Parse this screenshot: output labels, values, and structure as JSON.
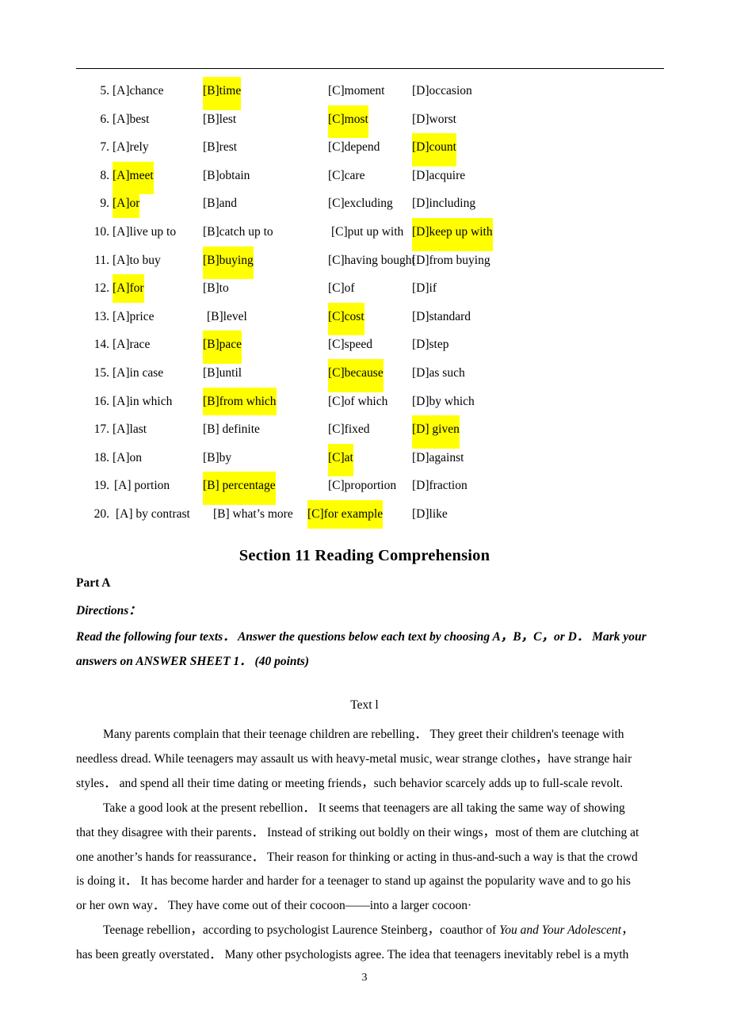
{
  "document": {
    "page_number": "3",
    "highlight_color": "#ffff00",
    "rule_color": "#000000"
  },
  "cloze": {
    "rows": [
      {
        "num": "5.",
        "a": "[A]chance",
        "b": "[B]time",
        "c": "[C]moment",
        "d": "[D]occasion",
        "highlight": "b"
      },
      {
        "num": "6.",
        "a": "[A]best",
        "b": "[B]lest",
        "c": "[C]most",
        "d": "[D]worst",
        "highlight": "c"
      },
      {
        "num": "7.",
        "a": "[A]rely",
        "b": "[B]rest",
        "c": "[C]depend",
        "d": "[D]count",
        "highlight": "d"
      },
      {
        "num": "8.",
        "a": "[A]meet",
        "b": "[B]obtain",
        "c": "[C]care",
        "d": "[D]acquire",
        "highlight": "a"
      },
      {
        "num": "9.",
        "a": "[A]or",
        "b": "[B]and",
        "c": "[C]excluding",
        "d": "[D]including",
        "highlight": "a"
      },
      {
        "num": "10.",
        "a": "[A]live up to",
        "b": "[B]catch up to",
        "c": "[C]put up with",
        "d": "[D]keep up with",
        "highlight": "d"
      },
      {
        "num": "11.",
        "a": "[A]to buy",
        "b": "[B]buying",
        "c": "[C]having bought",
        "d": "[D]from buying",
        "highlight": "b"
      },
      {
        "num": "12.",
        "a": "[A]for",
        "b": "[B]to",
        "c": "[C]of",
        "d": "[D]if",
        "highlight": "a"
      },
      {
        "num": "13.",
        "a": "[A]price",
        "b": "[B]level",
        "c": "[C]cost",
        "d": "[D]standard",
        "highlight": "c"
      },
      {
        "num": "14.",
        "a": "[A]race",
        "b": "[B]pace",
        "c": "[C]speed",
        "d": "[D]step",
        "highlight": "b"
      },
      {
        "num": "15.",
        "a": "[A]in case",
        "b": "[B]until",
        "c": "[C]because",
        "d": "[D]as such",
        "highlight": "c"
      },
      {
        "num": "16.",
        "a": "[A]in which",
        "b": "[B]from which",
        "c": "[C]of which",
        "d": "[D]by which",
        "highlight": "b"
      },
      {
        "num": "17.",
        "a": "[A]last",
        "b": "[B] definite",
        "c": "[C]fixed",
        "d": "[D] given",
        "highlight": "d"
      },
      {
        "num": "18.",
        "a": "[A]on",
        "b": "[B]by",
        "c": "[C]at",
        "d": "[D]against",
        "highlight": "c"
      },
      {
        "num": "19.",
        "a": "[A] portion",
        "b": "[B] percentage",
        "c": "[C]proportion",
        "d": "[D]fraction",
        "highlight": "b"
      },
      {
        "num": "20.",
        "a": "[A] by contrast",
        "b": "[B] what’s more",
        "c": "[C]for example",
        "d": "[D]like",
        "highlight": "c"
      }
    ]
  },
  "section": {
    "heading": "Section 11 Reading Comprehension",
    "part_label": "Part A",
    "directions_label": "Directions：",
    "directions_line1": "Read the following four texts． Answer the questions below each text by choosing A，B，C，or D． Mark your",
    "directions_line2": "answers on ANSWER SHEET 1． (40 points)"
  },
  "text1": {
    "label": "Text l",
    "paragraph1": {
      "line1": "Many parents complain that their teenage children are rebelling．  They greet their children's teenage with",
      "line2": "needless dread. While teenagers may assault us with heavy-metal music, wear strange clothes，have strange hair",
      "line3": "styles． and spend all their time dating or meeting friends，such behavior scarcely adds up to full-scale revolt."
    },
    "paragraph2": {
      "line1": "Take a good look at the present rebellion．  It seems that teenagers are all taking the same way of showing",
      "line2": "that they disagree with their parents． Instead of striking out boldly on their wings，most of them are clutching at",
      "line3": "one another’s hands for reassurance． Their reason for thinking or acting in thus-and-such a way is that the crowd",
      "line4": "is doing it．  It has become harder and harder for a teenager to stand up against the popularity wave and to go his",
      "line5": "or her own way．  They have come out of their cocoon——into a larger cocoon·"
    },
    "paragraph3": {
      "line1_pre": "Teenage rebellion，according to psychologist Laurence Steinberg，coauthor of ",
      "line1_italic": "You and Your Adolescent",
      "line1_post": "，",
      "line2": "has been greatly overstated．  Many other psychologists agree. The idea that teenagers inevitably rebel is a myth"
    }
  }
}
